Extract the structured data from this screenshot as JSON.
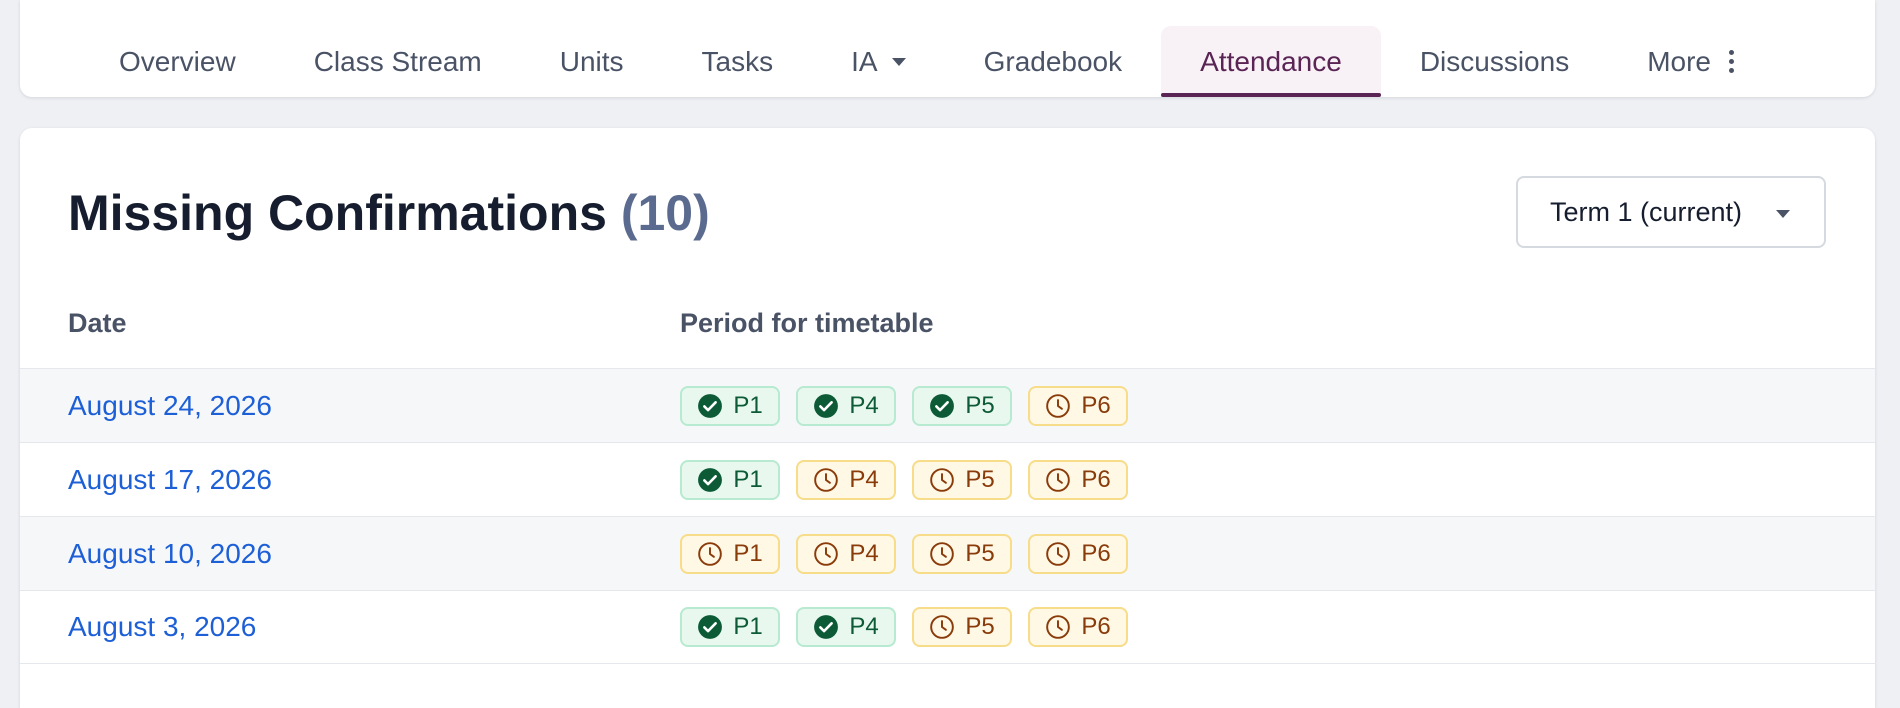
{
  "nav": {
    "tabs": [
      {
        "label": "Overview",
        "active": false
      },
      {
        "label": "Class Stream",
        "active": false
      },
      {
        "label": "Units",
        "active": false
      },
      {
        "label": "Tasks",
        "active": false
      },
      {
        "label": "IA",
        "active": false,
        "icon": "chevron-down-icon"
      },
      {
        "label": "Gradebook",
        "active": false
      },
      {
        "label": "Attendance",
        "active": true
      },
      {
        "label": "Discussions",
        "active": false
      },
      {
        "label": "More",
        "active": false,
        "icon": "kebab-menu-icon"
      }
    ]
  },
  "main": {
    "title": "Missing Confirmations",
    "count": "(10)",
    "term_select": {
      "value": "Term 1 (current)",
      "icon": "chevron-down-icon"
    },
    "columns": {
      "date": "Date",
      "period": "Period for timetable"
    },
    "rows": [
      {
        "date": "August 24, 2026",
        "periods": [
          {
            "label": "P1",
            "status": "confirmed"
          },
          {
            "label": "P4",
            "status": "confirmed"
          },
          {
            "label": "P5",
            "status": "confirmed"
          },
          {
            "label": "P6",
            "status": "pending"
          }
        ]
      },
      {
        "date": "August 17, 2026",
        "periods": [
          {
            "label": "P1",
            "status": "confirmed"
          },
          {
            "label": "P4",
            "status": "pending"
          },
          {
            "label": "P5",
            "status": "pending"
          },
          {
            "label": "P6",
            "status": "pending"
          }
        ]
      },
      {
        "date": "August 10, 2026",
        "periods": [
          {
            "label": "P1",
            "status": "pending"
          },
          {
            "label": "P4",
            "status": "pending"
          },
          {
            "label": "P5",
            "status": "pending"
          },
          {
            "label": "P6",
            "status": "pending"
          }
        ]
      },
      {
        "date": "August 3, 2026",
        "periods": [
          {
            "label": "P1",
            "status": "confirmed"
          },
          {
            "label": "P4",
            "status": "confirmed"
          },
          {
            "label": "P5",
            "status": "pending"
          },
          {
            "label": "P6",
            "status": "pending"
          }
        ]
      }
    ]
  },
  "colors": {
    "accent": "#5a2454",
    "link": "#1d5fd6",
    "confirmed_fg": "#0c5b36",
    "confirmed_bg": "#e8f8ee",
    "pending_fg": "#8a3b0a",
    "pending_bg": "#fff8e5"
  },
  "icons": {
    "confirmed": "check-circle-icon",
    "pending": "clock-icon"
  }
}
